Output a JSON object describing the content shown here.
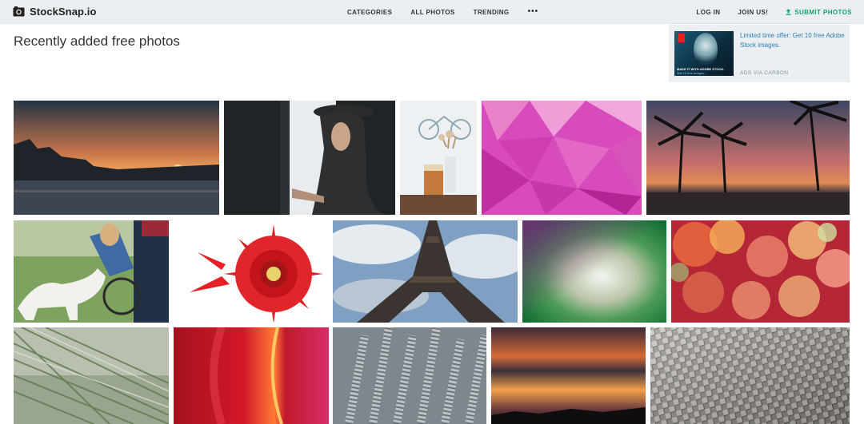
{
  "header": {
    "logo_text": "StockSnap.io",
    "nav": {
      "categories": "CATEGORIES",
      "all_photos": "ALL PHOTOS",
      "trending": "TRENDING",
      "more": "•••"
    },
    "right": {
      "login": "LOG IN",
      "join": "JOIN US!",
      "submit": "SUBMIT PHOTOS"
    }
  },
  "page": {
    "title": "Recently added free photos"
  },
  "ad": {
    "text": "Limited time offer: Get 10 free Adobe Stock images.",
    "via": "ADS VIA CARBON",
    "image_caption": "MAKE IT WITH ADOBE STOCK.",
    "image_sub": "Get 10 free images ›"
  },
  "photos": [
    {
      "name": "photo-paris-sunset-river",
      "subject": "sunset over river with Paris buildings"
    },
    {
      "name": "photo-woman-in-hat-window",
      "subject": "woman in hat by window"
    },
    {
      "name": "photo-iced-coffee-flowers",
      "subject": "iced coffee and dried flowers"
    },
    {
      "name": "photo-pink-polygon-pattern",
      "subject": "pink low-poly pattern"
    },
    {
      "name": "photo-palm-trees-sunset",
      "subject": "palm trees at sunset on beach"
    },
    {
      "name": "photo-dog-wheelchair",
      "subject": "dog with person in wheelchair"
    },
    {
      "name": "photo-red-gerbera",
      "subject": "red gerbera daisy"
    },
    {
      "name": "photo-eiffel-tower",
      "subject": "Eiffel Tower from below"
    },
    {
      "name": "photo-purple-green-gradient",
      "subject": "purple green gradient pattern"
    },
    {
      "name": "photo-bokeh-lights",
      "subject": "colorful bokeh lights"
    },
    {
      "name": "photo-pine-needles",
      "subject": "pine needles closeup"
    },
    {
      "name": "photo-red-abstract-light",
      "subject": "red abstract light"
    },
    {
      "name": "photo-metal-screws",
      "subject": "metal screws closeup"
    },
    {
      "name": "photo-orange-sunset-sky",
      "subject": "orange sunset sky"
    },
    {
      "name": "photo-metal-texture",
      "subject": "knurled metal texture"
    }
  ]
}
